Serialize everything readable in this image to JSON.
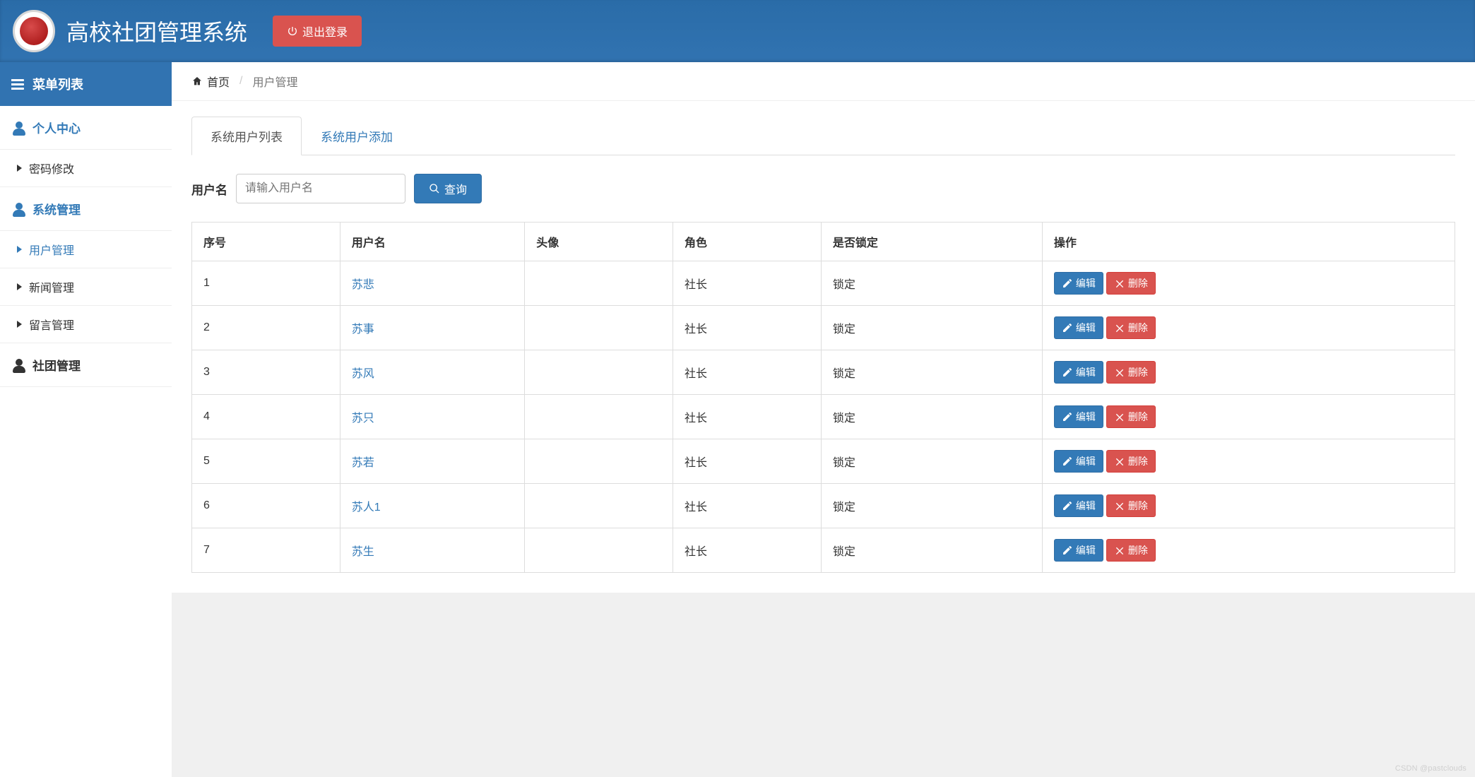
{
  "header": {
    "title": "高校社团管理系统",
    "logout": "退出登录"
  },
  "sidebar": {
    "header": "菜单列表",
    "sections": {
      "personal": {
        "label": "个人中心",
        "items": [
          {
            "label": "密码修改"
          }
        ]
      },
      "system": {
        "label": "系统管理",
        "items": [
          {
            "label": "用户管理"
          },
          {
            "label": "新闻管理"
          },
          {
            "label": "留言管理"
          }
        ]
      },
      "club": {
        "label": "社团管理"
      }
    }
  },
  "breadcrumb": {
    "home": "首页",
    "current": "用户管理"
  },
  "tabs": [
    {
      "label": "系统用户列表",
      "active": true
    },
    {
      "label": "系统用户添加",
      "active": false
    }
  ],
  "search": {
    "label": "用户名",
    "placeholder": "请输入用户名",
    "button": "查询"
  },
  "table": {
    "headers": [
      "序号",
      "用户名",
      "头像",
      "角色",
      "是否锁定",
      "操作"
    ],
    "edit_label": "编辑",
    "delete_label": "删除",
    "rows": [
      {
        "seq": "1",
        "username": "苏悲",
        "avatar": "",
        "role": "社长",
        "locked": "锁定"
      },
      {
        "seq": "2",
        "username": "苏事",
        "avatar": "",
        "role": "社长",
        "locked": "锁定"
      },
      {
        "seq": "3",
        "username": "苏风",
        "avatar": "",
        "role": "社长",
        "locked": "锁定"
      },
      {
        "seq": "4",
        "username": "苏只",
        "avatar": "",
        "role": "社长",
        "locked": "锁定"
      },
      {
        "seq": "5",
        "username": "苏若",
        "avatar": "",
        "role": "社长",
        "locked": "锁定"
      },
      {
        "seq": "6",
        "username": "苏人1",
        "avatar": "",
        "role": "社长",
        "locked": "锁定"
      },
      {
        "seq": "7",
        "username": "苏生",
        "avatar": "",
        "role": "社长",
        "locked": "锁定"
      }
    ]
  },
  "watermark": "CSDN @pastclouds"
}
